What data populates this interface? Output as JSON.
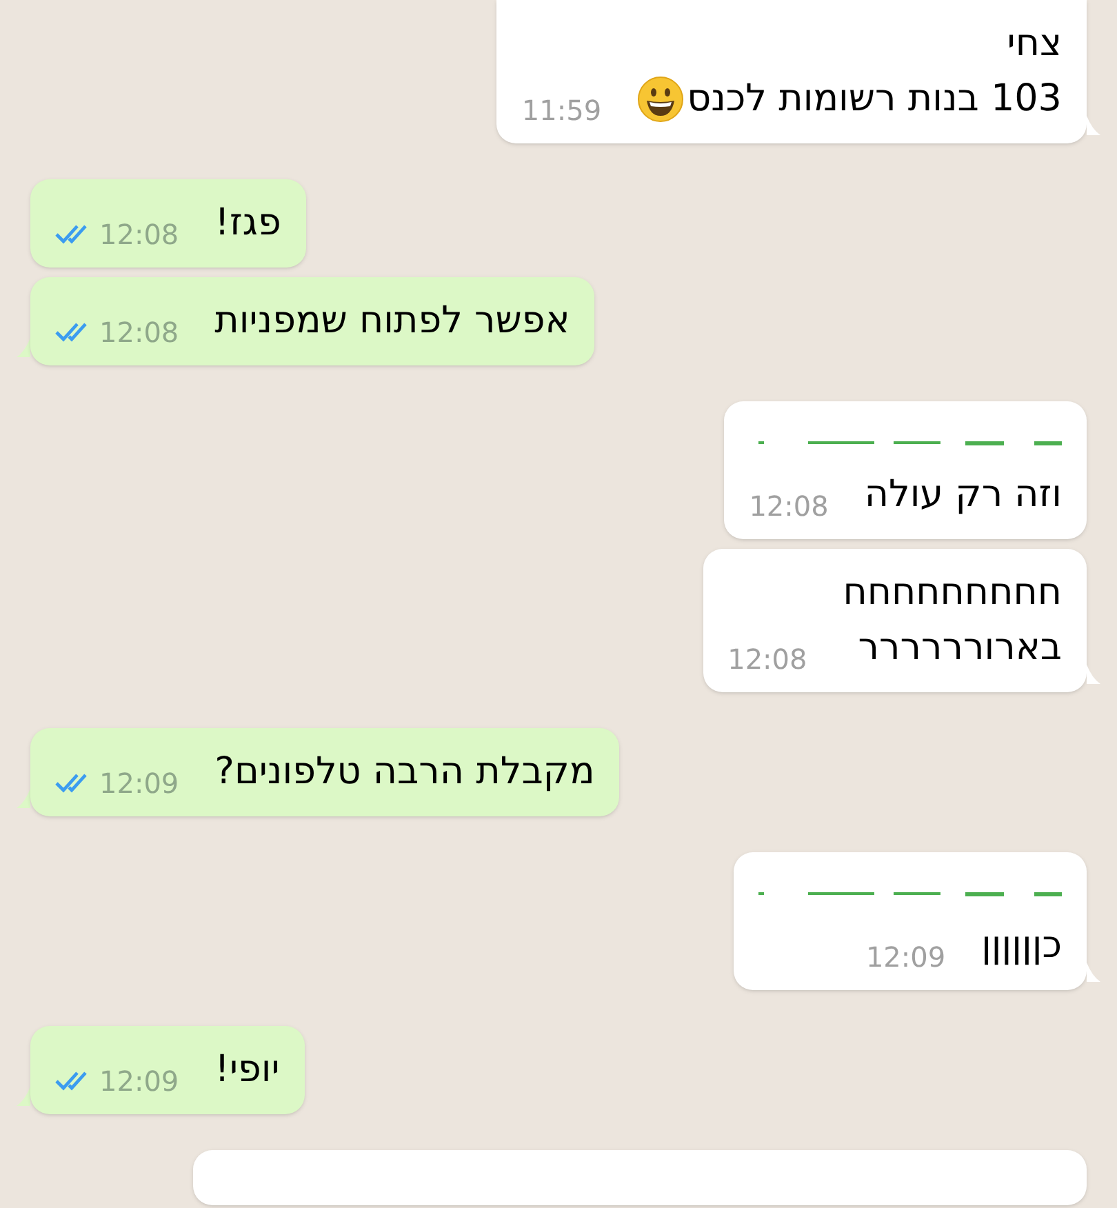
{
  "messages": [
    {
      "kind": "incoming",
      "sender": "צחי",
      "lines": [
        "103 בנות רשומות לכנס"
      ],
      "emoji": true,
      "time": "11:59",
      "tail": true
    },
    {
      "kind": "outgoing",
      "lines": [
        "פגז!"
      ],
      "time": "12:08",
      "read": true,
      "tail": false
    },
    {
      "kind": "outgoing",
      "lines": [
        "אפשר לפתוח שמפניות"
      ],
      "time": "12:08",
      "read": true,
      "tail": true
    },
    {
      "kind": "incoming",
      "redacted_sender": true,
      "lines": [
        "וזה רק עולה"
      ],
      "time": "12:08",
      "tail": false
    },
    {
      "kind": "incoming",
      "lines": [
        "חחחחחחחחח",
        "בארורררררר"
      ],
      "time": "12:08",
      "tail": true
    },
    {
      "kind": "outgoing",
      "lines": [
        "מקבלת הרבה טלפונים?"
      ],
      "time": "12:09",
      "read": true,
      "tail": true
    },
    {
      "kind": "incoming",
      "redacted_sender": true,
      "lines": [
        "כןןןןןן"
      ],
      "time": "12:09",
      "tail": true
    },
    {
      "kind": "outgoing",
      "lines": [
        "יופי!"
      ],
      "time": "12:09",
      "read": true,
      "tail": true
    },
    {
      "kind": "cut_off"
    }
  ]
}
